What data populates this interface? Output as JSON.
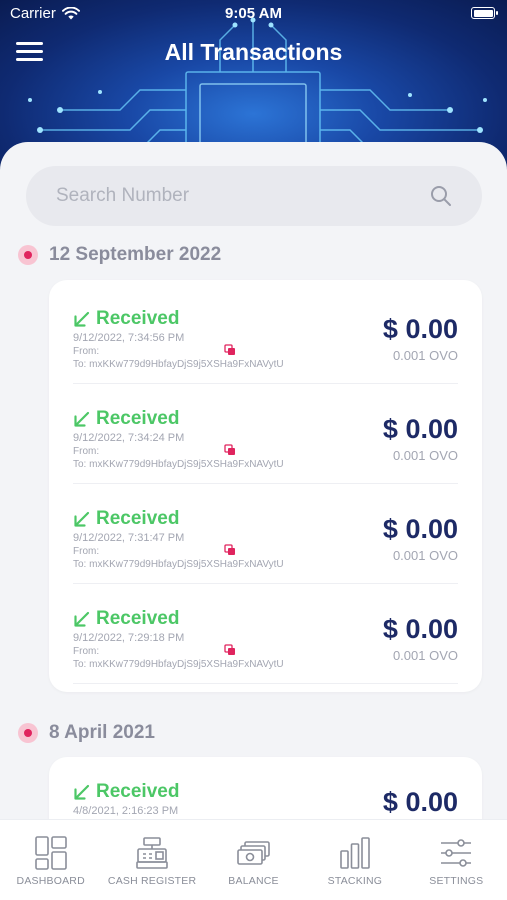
{
  "status_bar": {
    "carrier": "Carrier",
    "time": "9:05 AM"
  },
  "header": {
    "title": "All Transactions",
    "menu_icon": "hamburger-menu-icon"
  },
  "search": {
    "placeholder": "Search Number",
    "value": "",
    "icon": "search-icon"
  },
  "colors": {
    "received": "#4cc766",
    "amount": "#1d2a66",
    "date_dot": "#e0245e",
    "copy_icon": "#e0245e",
    "header_bg": "#1948a6"
  },
  "groups": [
    {
      "date": "12 September 2022",
      "transactions": [
        {
          "status": "Received",
          "datetime": "9/12/2022, 7:34:56 PM",
          "from": "From:",
          "to": "To: mxKKw779d9HbfayDjS9j5XSHa9FxNAVytU",
          "amount": "$ 0.00",
          "sub_amount": "0.001 OVO"
        },
        {
          "status": "Received",
          "datetime": "9/12/2022, 7:34:24 PM",
          "from": "From:",
          "to": "To: mxKKw779d9HbfayDjS9j5XSHa9FxNAVytU",
          "amount": "$ 0.00",
          "sub_amount": "0.001 OVO"
        },
        {
          "status": "Received",
          "datetime": "9/12/2022, 7:31:47 PM",
          "from": "From:",
          "to": "To: mxKKw779d9HbfayDjS9j5XSHa9FxNAVytU",
          "amount": "$ 0.00",
          "sub_amount": "0.001 OVO"
        },
        {
          "status": "Received",
          "datetime": "9/12/2022, 7:29:18 PM",
          "from": "From:",
          "to": "To: mxKKw779d9HbfayDjS9j5XSHa9FxNAVytU",
          "amount": "$ 0.00",
          "sub_amount": "0.001 OVO"
        }
      ]
    },
    {
      "date": "8 April 2021",
      "transactions": [
        {
          "status": "Received",
          "datetime": "4/8/2021, 2:16:23 PM",
          "amount": "$ 0.00"
        }
      ]
    }
  ],
  "tabbar": [
    {
      "label": "DASHBOARD",
      "icon": "dashboard-icon"
    },
    {
      "label": "CASH REGISTER",
      "icon": "cash-register-icon"
    },
    {
      "label": "BALANCE",
      "icon": "balance-icon"
    },
    {
      "label": "STACKING",
      "icon": "stacking-icon"
    },
    {
      "label": "SETTINGS",
      "icon": "settings-icon"
    }
  ]
}
